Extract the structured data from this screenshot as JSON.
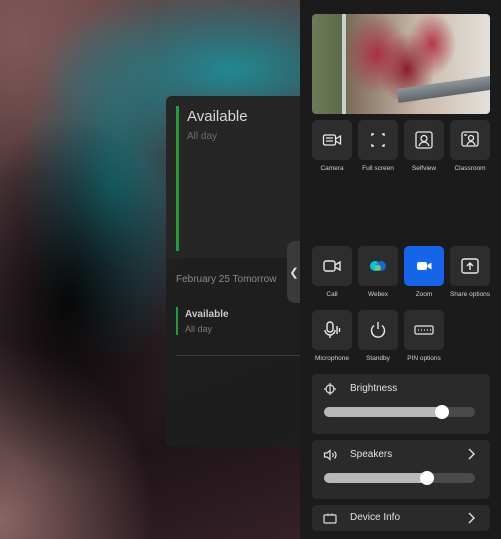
{
  "calendar": {
    "status_title": "Available",
    "status_sub": "All day",
    "date_heading": "February 25 Tomorrow",
    "item_title": "Available",
    "item_sub": "All day"
  },
  "panel": {
    "row1": [
      {
        "label": "Camera",
        "icon": "camera-settings-icon"
      },
      {
        "label": "Full screen",
        "icon": "fullscreen-icon"
      },
      {
        "label": "Selfview",
        "icon": "selfview-icon"
      },
      {
        "label": "Classroom",
        "icon": "classroom-icon"
      }
    ],
    "row2": [
      {
        "label": "Call",
        "icon": "video-call-icon"
      },
      {
        "label": "Webex",
        "icon": "webex-icon"
      },
      {
        "label": "Zoom",
        "icon": "zoom-icon"
      },
      {
        "label": "Share options",
        "icon": "share-icon"
      }
    ],
    "row3": [
      {
        "label": "Microphone",
        "icon": "microphone-icon"
      },
      {
        "label": "Standby",
        "icon": "power-icon"
      },
      {
        "label": "PIN options",
        "icon": "keypad-icon"
      }
    ],
    "brightness": {
      "label": "Brightness",
      "level": 0.78
    },
    "speakers": {
      "label": "Speakers",
      "level": 0.68
    },
    "device_info": {
      "label": "Device Info"
    }
  },
  "colors": {
    "available_green": "#1f9d3c",
    "zoom_blue": "#1565e8",
    "panel_bg": "#1b1b1b",
    "tile_bg": "#2d2d2d"
  }
}
